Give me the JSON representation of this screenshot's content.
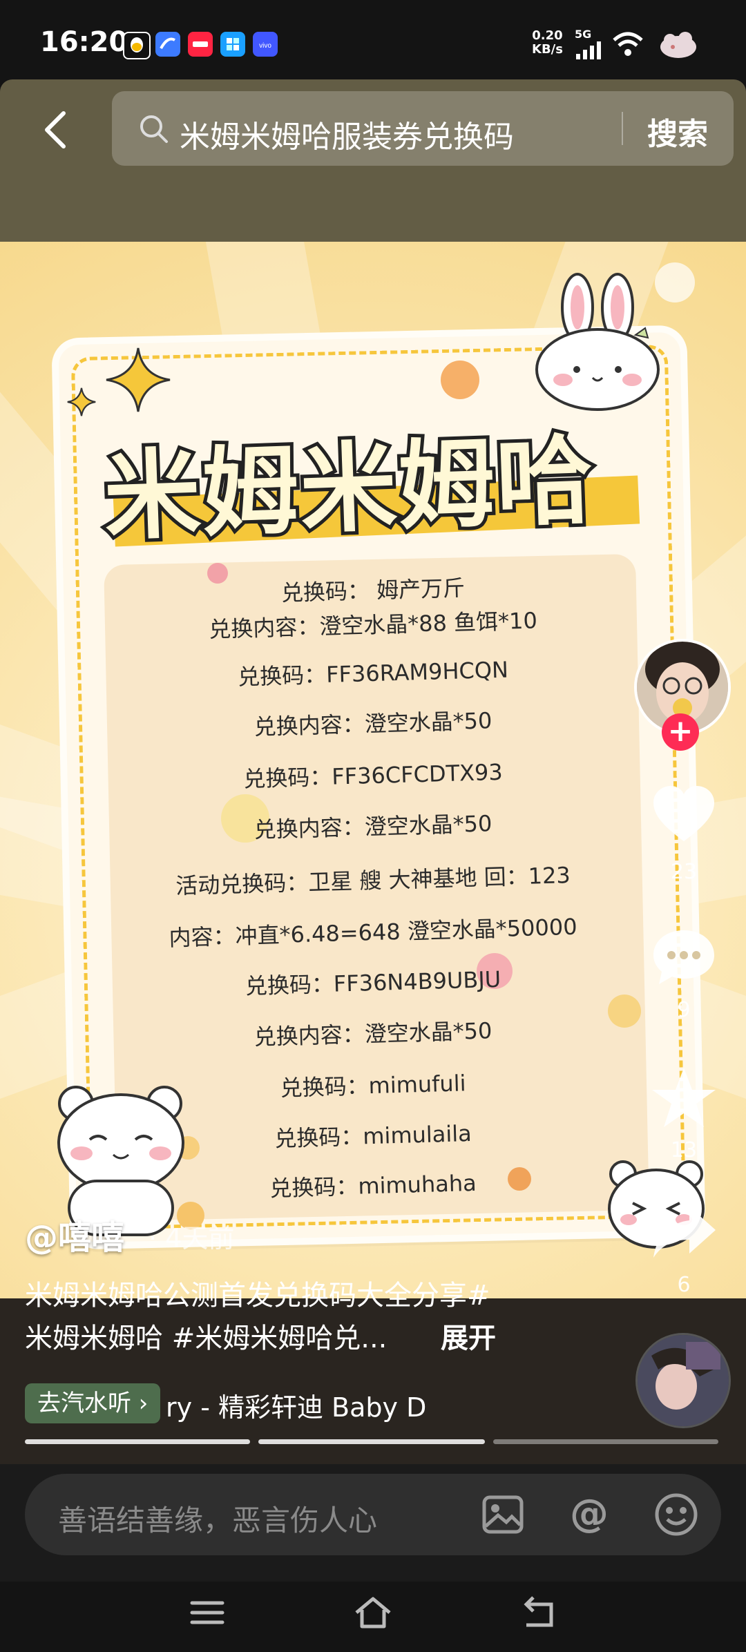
{
  "status_bar": {
    "time": "16:20",
    "net_speed_value": "0.20",
    "net_speed_unit": "KB/s",
    "network": "5G",
    "app_icons": [
      "qq-icon",
      "blue-app-icon",
      "xiaohongshu-icon",
      "app-store-icon",
      "vivo-icon"
    ]
  },
  "search": {
    "query": "米姆米姆哈服装券兑换码",
    "button_label": "搜索"
  },
  "poster": {
    "title": "米姆米姆哈",
    "lines": [
      "兑换码：  姆产万斤",
      "兑换内容：澄空水晶*88 鱼饵*10",
      "兑换码：FF36RAM9HCQN",
      "兑换内容：澄空水晶*50",
      "兑换码：FF36CFCDTX93",
      "兑换内容：澄空水晶*50",
      "活动兑换码：卫星 艘 大神基地 回：123",
      "内容：冲直*6.48=648  澄空水晶*50000",
      "兑换码：FF36N4B9UBJU",
      "兑换内容：澄空水晶*50",
      "兑换码：mimufuli",
      "兑换码：mimulaila",
      "兑换码：mimuhaha"
    ]
  },
  "rail": {
    "likes": "23",
    "comments": "9",
    "favorites": "13",
    "shares": "6"
  },
  "post": {
    "author": "@嘻嘻",
    "time_ago": "· 4天前",
    "desc_line1": "米姆米姆哈公测首发兑换码大全分享#",
    "desc_line2": "米姆米姆哈 #米姆米姆哈兑...",
    "expand_label": "展开",
    "chip_label": "去汽水听 ›",
    "music_text": "ry - 精彩轩迪     Baby D"
  },
  "comment": {
    "placeholder": "善语结善缘，恶言伤人心"
  },
  "colors": {
    "accent_red": "#fe2c55",
    "search_header": "#635d45",
    "poster_yellow": "#f5c73a"
  }
}
